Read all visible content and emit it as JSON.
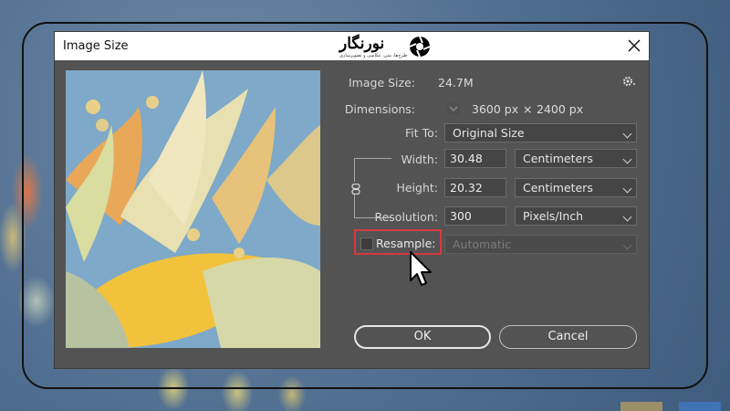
{
  "dialog": {
    "title": "Image Size",
    "logo_text": "نورنگار",
    "logo_tagline": "طرح‌ها، متن، عکاسی و تصویرسازی"
  },
  "info": {
    "image_size_label": "Image Size:",
    "image_size_value": "24.7M",
    "dimensions_label": "Dimensions:",
    "dimensions_width": "3600 px",
    "dimensions_sep": "×",
    "dimensions_height": "2400 px",
    "fit_to_label": "Fit To:",
    "fit_to_value": "Original Size"
  },
  "fields": {
    "width_label": "Width:",
    "width_value": "30.48",
    "width_unit": "Centimeters",
    "height_label": "Height:",
    "height_value": "20.32",
    "height_unit": "Centimeters",
    "resolution_label": "Resolution:",
    "resolution_value": "300",
    "resolution_unit": "Pixels/Inch",
    "resample_label": "Resample:",
    "resample_checked": false,
    "resample_method": "Automatic"
  },
  "buttons": {
    "ok": "OK",
    "cancel": "Cancel"
  },
  "colors": {
    "dialog_bg": "#535353",
    "highlight": "#d63a3a",
    "title_bar": "#ffffff"
  }
}
